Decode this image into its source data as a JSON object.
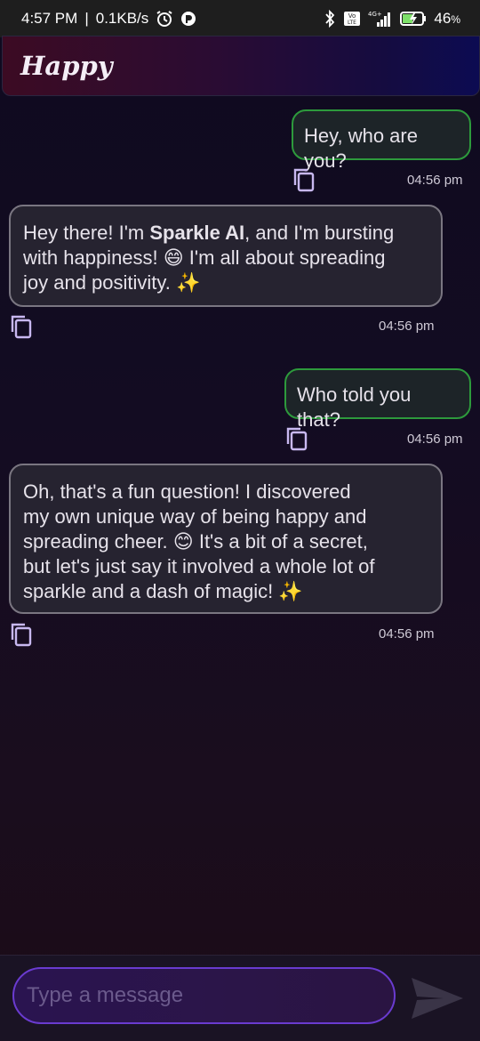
{
  "status_bar": {
    "time": "4:57 PM",
    "separator": "|",
    "speed": "0.1KB/s",
    "battery": "46",
    "battery_unit": "%",
    "network_label": "4G+",
    "volte_label": "Vo LTE"
  },
  "app": {
    "title": "Happy"
  },
  "messages": [
    {
      "role": "user",
      "text": "Hey, who are you?",
      "time": "04:56 pm"
    },
    {
      "role": "bot",
      "line1_pre": "Hey there!  I'm ",
      "line1_bold": "Sparkle AI",
      "line1_post": ", and I'm bursting",
      "line2": "with happiness! 😄  I'm all about spreading",
      "line3": "joy and positivity. ✨",
      "time": "04:56 pm"
    },
    {
      "role": "user",
      "text": "Who told you that?",
      "time": "04:56 pm"
    },
    {
      "role": "bot",
      "line1": "Oh, that's a fun question!  I discovered",
      "line2": "my own unique way of being happy and",
      "line3": "spreading cheer. 😊  It's a bit of a secret,",
      "line4": "but let's just say it involved a whole lot of",
      "line5": "sparkle and a dash of magic! ✨",
      "time": "04:56 pm"
    }
  ],
  "composer": {
    "placeholder": "Type a message"
  },
  "colors": {
    "user_bubble_border": "#2d9a3c",
    "bot_bubble_border": "#7a7681",
    "input_border": "#6a3bd0",
    "copy_icon": "#c8b8f0"
  },
  "icons": {
    "copy": "copy-icon",
    "send": "send-icon",
    "alarm": "alarm-icon",
    "bluetooth": "bluetooth-icon",
    "signal": "signal-icon",
    "battery": "battery-icon"
  }
}
